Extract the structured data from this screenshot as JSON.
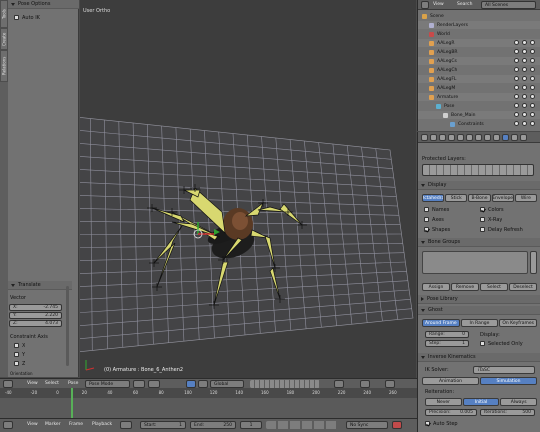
{
  "toolshelf": {
    "tabs": [
      "Tools",
      "Create",
      "Relations",
      "Animation",
      "Physics",
      "Grease Pencil"
    ],
    "pose_options_header": "Pose Options",
    "auto_ik_label": "Auto IK",
    "auto_ik_checked": false,
    "translate_header": "Translate",
    "vector_label": "Vector",
    "vector": [
      {
        "axis": "X:",
        "value": "-2.745"
      },
      {
        "axis": "Y:",
        "value": "2.220"
      },
      {
        "axis": "Z:",
        "value": "4.073"
      }
    ],
    "constraint_axis_label": "Constraint Axis",
    "constraint_axes": [
      "X",
      "Y",
      "Z"
    ],
    "orientation_label": "Orientation"
  },
  "viewport": {
    "view_label": "User Ortho",
    "status": "(0) Armature : Bone_6_Anthen2"
  },
  "viewport_header": {
    "items": [
      "View",
      "Select",
      "Pose"
    ],
    "mode": "Pose Mode",
    "orientation": "Global"
  },
  "timeline": {
    "ticks": [
      "-40",
      "-20",
      "0",
      "20",
      "40",
      "60",
      "80",
      "100",
      "120",
      "140",
      "160",
      "180",
      "200",
      "220",
      "240",
      "260"
    ]
  },
  "timeline_header": {
    "items": [
      "View",
      "Marker",
      "Frame",
      "Playback"
    ],
    "start_label": "Start:",
    "start_value": "1",
    "end_label": "End:",
    "end_value": "250",
    "current_frame": "1",
    "sync": "No Sync"
  },
  "outliner": {
    "header_view": "View",
    "header_search": "Search",
    "header_scope": "All Scenes",
    "rows": [
      {
        "label": "Scene",
        "indent": 0
      },
      {
        "label": "RenderLayers",
        "indent": 1
      },
      {
        "label": "World",
        "indent": 1
      },
      {
        "label": "AALegR",
        "indent": 1
      },
      {
        "label": "AALegBR",
        "indent": 1
      },
      {
        "label": "AALegCs",
        "indent": 1
      },
      {
        "label": "AALegCh",
        "indent": 1
      },
      {
        "label": "AALegFL",
        "indent": 1
      },
      {
        "label": "AALegM",
        "indent": 1
      },
      {
        "label": "Armature",
        "indent": 1
      },
      {
        "label": "Pose",
        "indent": 2
      },
      {
        "label": "Bone_Main",
        "indent": 3
      },
      {
        "label": "Constraints",
        "indent": 4
      }
    ]
  },
  "props": {
    "protected_layers": "Protected Layers:",
    "display_header": "Display",
    "display_types": [
      "Octahedral",
      "Stick",
      "B-Bone",
      "Envelope",
      "Wire"
    ],
    "display_active": "Octahedral",
    "display_opts_left": [
      "Names",
      "Axes",
      "Shapes"
    ],
    "display_opts_left_checked": [
      false,
      false,
      true
    ],
    "display_opts_right": [
      "Colors",
      "X-Ray",
      "Delay Refresh"
    ],
    "display_opts_right_checked": [
      true,
      false,
      false
    ],
    "bone_groups_header": "Bone Groups",
    "bone_group_buttons": [
      "Assign",
      "Remove",
      "Select",
      "Deselect"
    ],
    "pose_library_header": "Pose Library",
    "ghost_header": "Ghost",
    "ghost_modes": [
      "Around Frame",
      "In Range",
      "On Keyframes"
    ],
    "ghost_active": "Around Frame",
    "range_label": "Range:",
    "range_value": "0",
    "step_label": "Step:",
    "step_value": "1",
    "display_label": "Display:",
    "selected_only": "Selected Only",
    "ik_header": "Inverse Kinematics",
    "ik_solver_label": "IK Solver:",
    "ik_solver_value": "iTaSC",
    "ik_modes": [
      "Animation",
      "Simulation"
    ],
    "ik_active": "Simulation",
    "reiteration_label": "Reiteration:",
    "reiteration_opts": [
      "Never",
      "Initial",
      "Always"
    ],
    "reiteration_active": "Initial",
    "precision_label": "Precision:",
    "precision_value": "0.005",
    "iterations_label": "Iterations:",
    "iterations_value": "500",
    "auto_step": "Auto Step"
  },
  "colors": {
    "accent": "#5680c2",
    "bone_yellow": "#d8d870",
    "body_brown": "#5a3a24",
    "grid_line": "#9a9aa8"
  }
}
